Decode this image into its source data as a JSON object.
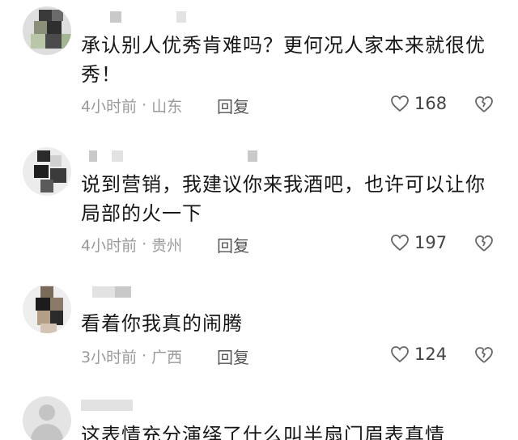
{
  "comments": [
    {
      "text": "承认别人优秀肯难吗？更何况人家本来就很优秀！",
      "time": "4小时前",
      "location": "山东",
      "reply_label": "回复",
      "likes": "168"
    },
    {
      "text": "说到营销，我建议你来我酒吧，也许可以让你局部的火一下",
      "time": "4小时前",
      "location": "贵州",
      "reply_label": "回复",
      "likes": "197"
    },
    {
      "text": "看着你我真的闹腾",
      "time": "3小时前",
      "location": "广西",
      "reply_label": "回复",
      "likes": "124"
    },
    {
      "text": "这表情充分演绎了什么叫半扇门眉表真情"
    }
  ],
  "meta_separator": "·",
  "colors": {
    "text": "#161616",
    "meta": "#9a9a9a",
    "icon": "#555555"
  },
  "icons": {
    "like": "heart-icon",
    "dislike": "broken-heart-icon"
  }
}
